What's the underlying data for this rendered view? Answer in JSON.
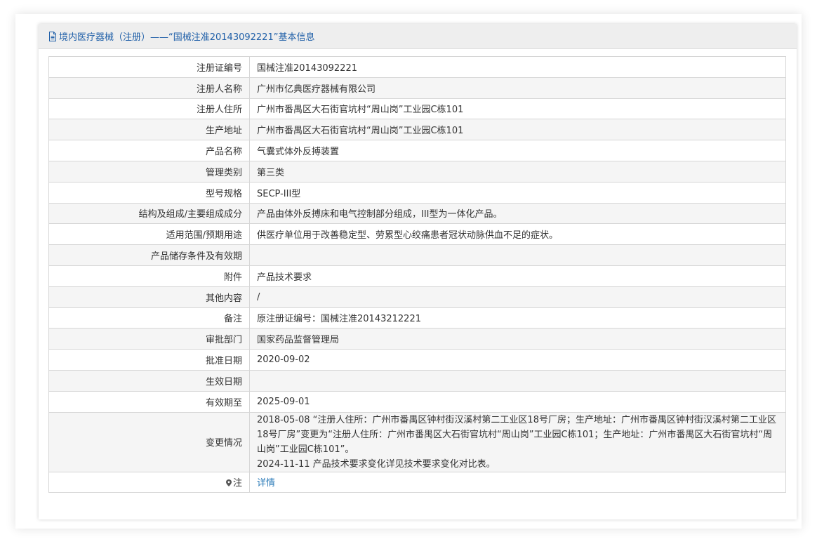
{
  "header": {
    "title": "境内医疗器械（注册）——“国械注准20143092221”基本信息"
  },
  "rows": [
    {
      "label": "注册证编号",
      "value": "国械注准20143092221"
    },
    {
      "label": "注册人名称",
      "value": "广州市亿典医疗器械有限公司"
    },
    {
      "label": "注册人住所",
      "value": "广州市番禺区大石街官坑村“周山岗”工业园C栋101"
    },
    {
      "label": "生产地址",
      "value": "广州市番禺区大石街官坑村“周山岗”工业园C栋101"
    },
    {
      "label": "产品名称",
      "value": "气囊式体外反搏装置"
    },
    {
      "label": "管理类别",
      "value": "第三类"
    },
    {
      "label": "型号规格",
      "value": "SECP-III型"
    },
    {
      "label": "结构及组成/主要组成成分",
      "value": "产品由体外反搏床和电气控制部分组成，III型为一体化产品。"
    },
    {
      "label": "适用范围/预期用途",
      "value": "供医疗单位用于改善稳定型、劳累型心绞痛患者冠状动脉供血不足的症状。"
    },
    {
      "label": "产品储存条件及有效期",
      "value": ""
    },
    {
      "label": "附件",
      "value": "产品技术要求"
    },
    {
      "label": "其他内容",
      "value": "/"
    },
    {
      "label": "备注",
      "value": "原注册证编号：国械注准20143212221"
    },
    {
      "label": "审批部门",
      "value": "国家药品监督管理局"
    },
    {
      "label": "批准日期",
      "value": "2020-09-02"
    },
    {
      "label": "生效日期",
      "value": ""
    },
    {
      "label": "有效期至",
      "value": "2025-09-01"
    }
  ],
  "changes": {
    "label": "变更情况",
    "lines": [
      "2018-05-08 “注册人住所：广州市番禺区钟村街汉溪村第二工业区18号厂房；生产地址：广州市番禺区钟村街汉溪村第二工业区18号厂房”变更为“注册人住所：广州市番禺区大石街官坑村“周山岗”工业园C栋101；生产地址：广州市番禺区大石街官坑村“周山岗”工业园C栋101”。",
      "2024-11-11 产品技术要求变化详见技术要求变化对比表。"
    ]
  },
  "note": {
    "label": "注",
    "link": "详情"
  }
}
